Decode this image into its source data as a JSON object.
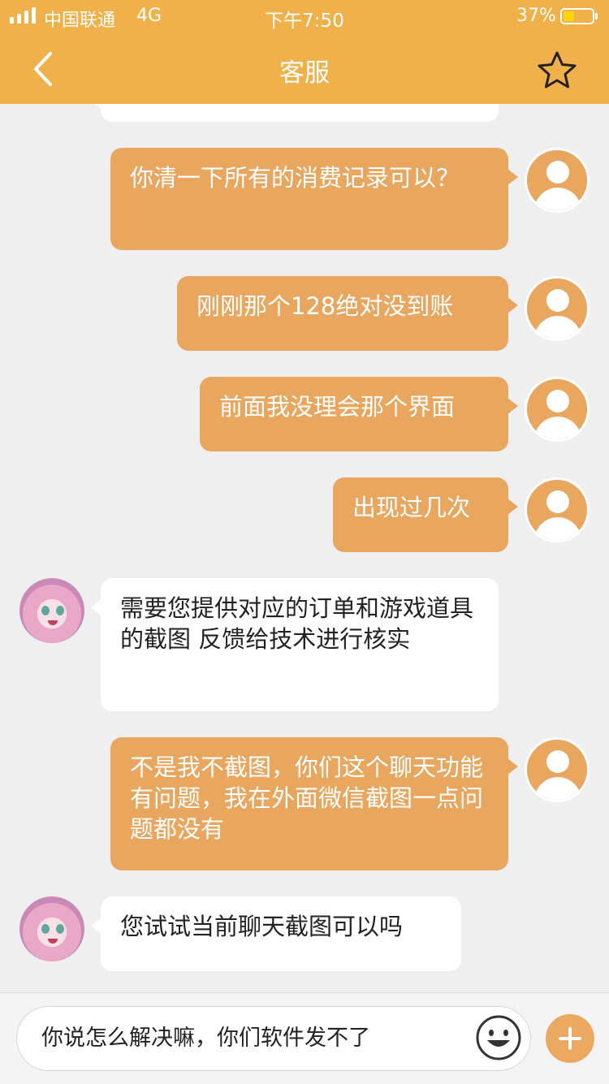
{
  "status_bar": {
    "carrier": "中国联通",
    "network": "4G",
    "time": "下午7:50",
    "battery_percent": "37%",
    "battery_level": 0.37
  },
  "header": {
    "title": "客服",
    "back_icon": "chevron-left-icon",
    "favorite_icon": "star-outline-icon"
  },
  "colors": {
    "header": "#f0b04a",
    "outgoing_bubble": "#e8a65e",
    "incoming_bubble": "#ffffff",
    "background": "#efefef"
  },
  "messages": [
    {
      "sender": "user",
      "text": "你清一下所有的消费记录可以？"
    },
    {
      "sender": "user",
      "text": "刚刚那个128绝对没到账"
    },
    {
      "sender": "user",
      "text": "前面我没理会那个界面"
    },
    {
      "sender": "user",
      "text": "出现过几次"
    },
    {
      "sender": "agent",
      "text": "需要您提供对应的订单和游戏道具的截图 反馈给技术进行核实"
    },
    {
      "sender": "user",
      "text": "不是我不截图，你们这个聊天功能有问题，我在外面微信截图一点问题都没有"
    },
    {
      "sender": "agent",
      "text": "您试试当前聊天截图可以吗"
    }
  ],
  "composer": {
    "value": "你说怎么解决嘛，你们软件发不了",
    "emoji_icon": "smiley-icon",
    "plus_icon": "plus-icon"
  }
}
